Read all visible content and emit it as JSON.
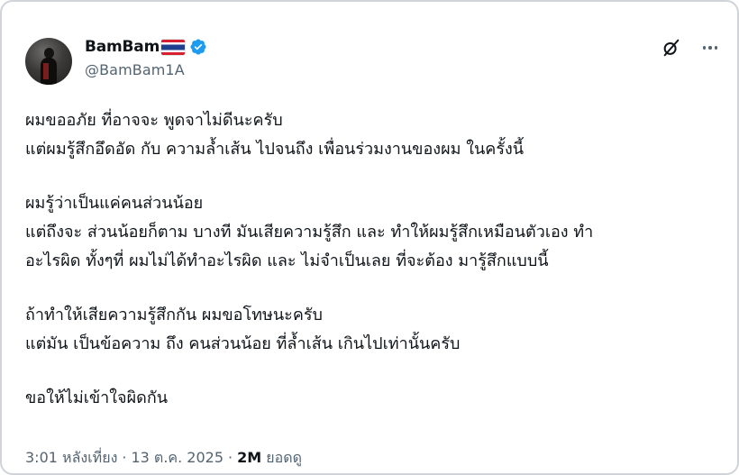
{
  "post": {
    "author": {
      "display_name": "BamBam",
      "handle": "@BamBam1A",
      "flag_icon": "thailand-flag-icon",
      "verified_icon": "verified-badge-icon",
      "verified_color": "#1d9bf0"
    },
    "paragraphs": [
      [
        "ผมขออภัย ที่อาจจะ พูดจาไม่ดีนะครับ",
        "แต่ผมรู้สึกอึดอัด กับ ความล้ำเส้น ไปจนถึง เพื่อนร่วมงานของผม ในครั้งนี้"
      ],
      [
        "ผมรู้ว่าเป็นแค่คนส่วนน้อย",
        "แต่ถึงจะ ส่วนน้อยก็ตาม บางที มันเสียความรู้สึก และ ทำให้ผมรู้สึกเหมือนตัวเอง ทำ",
        "อะไรผิด ทั้งๆที่ ผมไม่ได้ทำอะไรผิด และ ไม่จำเป็นเลย ที่จะต้อง มารู้สึกแบบนี้"
      ],
      [
        "ถ้าทำให้เสียความรู้สึกกัน ผมขอโทษนะครับ",
        "แต่มัน เป็นข้อความ ถึง คนส่วนน้อย ที่ล้ำเส้น เกินไปเท่านั้นครับ"
      ],
      [
        "ขอให้ไม่เข้าใจผิดกัน"
      ]
    ],
    "meta": {
      "time": "3:01 หลังเที่ยง",
      "separator": "·",
      "date": "13 ต.ค. 2025",
      "views_count": "2M",
      "views_label": "ยอดดู"
    }
  },
  "actions": {
    "grok_icon": "grok-icon",
    "more_icon": "more-options-icon"
  },
  "colors": {
    "text_primary": "#0f1419",
    "text_secondary": "#536471",
    "accent": "#1d9bf0"
  }
}
